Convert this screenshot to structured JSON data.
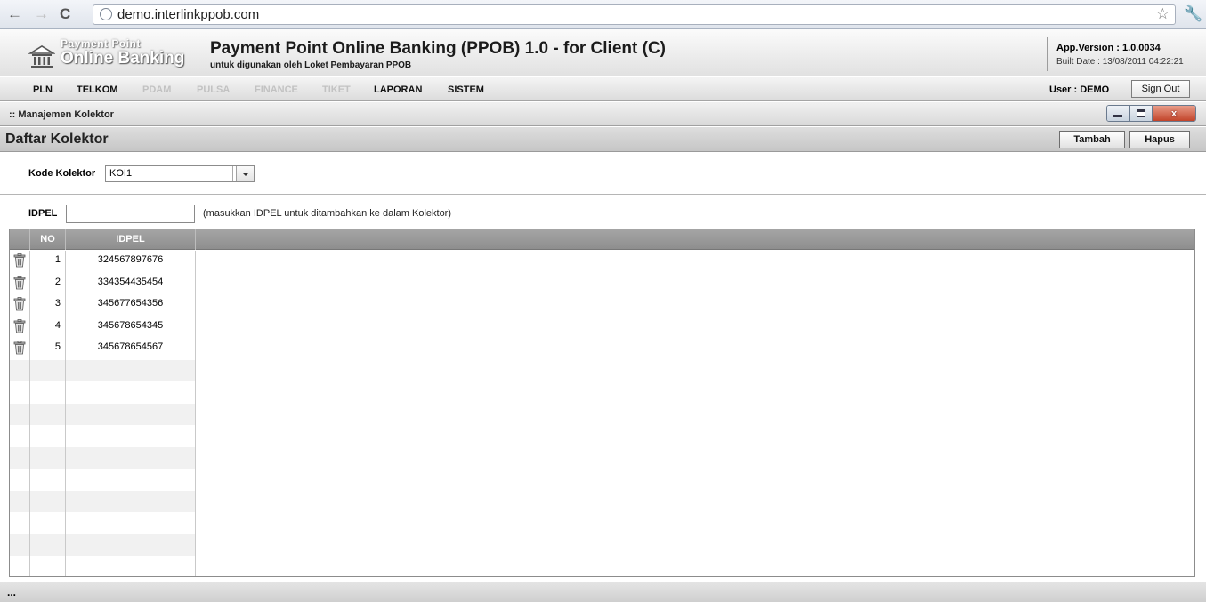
{
  "browser": {
    "url": "demo.interlinkppob.com"
  },
  "header": {
    "logo_line1": "Payment Point",
    "logo_line2": "Online Banking",
    "title": "Payment Point Online Banking (PPOB)  1.0 - for Client (C)",
    "subtitle": "untuk digunakan oleh Loket Pembayaran PPOB",
    "app_version": "App.Version : 1.0.0034",
    "built_date": "Built Date : 13/08/2011 04:22:21"
  },
  "menu": {
    "items": [
      {
        "label": "PLN",
        "enabled": true
      },
      {
        "label": "TELKOM",
        "enabled": true
      },
      {
        "label": "PDAM",
        "enabled": false
      },
      {
        "label": "PULSA",
        "enabled": false
      },
      {
        "label": "FINANCE",
        "enabled": false
      },
      {
        "label": "TIKET",
        "enabled": false
      },
      {
        "label": "LAPORAN",
        "enabled": true
      },
      {
        "label": "SISTEM",
        "enabled": true
      }
    ],
    "user_label": "User : DEMO",
    "signout_label": "Sign Out"
  },
  "window": {
    "title": ":: Manajemen Kolektor",
    "close_glyph": "x"
  },
  "panel": {
    "title": "Daftar Kolektor",
    "add_label": "Tambah",
    "delete_label": "Hapus"
  },
  "form": {
    "kode_label": "Kode Kolektor",
    "kode_value": "KOI1",
    "idpel_label": "IDPEL",
    "idpel_value": "",
    "idpel_hint": "(masukkan IDPEL untuk ditambahkan ke dalam Kolektor)"
  },
  "grid": {
    "columns": [
      "NO",
      "IDPEL"
    ],
    "rows": [
      {
        "no": "1",
        "idpel": "324567897676"
      },
      {
        "no": "2",
        "idpel": "334354435454"
      },
      {
        "no": "3",
        "idpel": "345677654356"
      },
      {
        "no": "4",
        "idpel": "345678654345"
      },
      {
        "no": "5",
        "idpel": "345678654567"
      }
    ],
    "empty_rows": 10
  },
  "status": {
    "text": "..."
  }
}
